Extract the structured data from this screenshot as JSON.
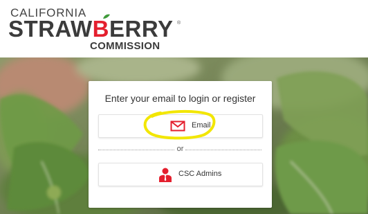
{
  "logo": {
    "line1": "CALIFORNIA",
    "line2_part1": "STRAW",
    "line2_accent": "B",
    "line2_part2": "ERRY",
    "registered": "®",
    "line3": "COMMISSION"
  },
  "login": {
    "title": "Enter your email to login or register",
    "email_button_label": "Email",
    "divider_text": "or",
    "admins_button_label": "CSC Admins"
  },
  "colors": {
    "brand_red": "#e41f2e",
    "logo_gray": "#3b3b3b",
    "highlight_yellow": "#f2e600"
  },
  "icons": {
    "email": "envelope-icon",
    "admins": "admin-person-icon",
    "logo_leaf": "leaf-icon"
  }
}
